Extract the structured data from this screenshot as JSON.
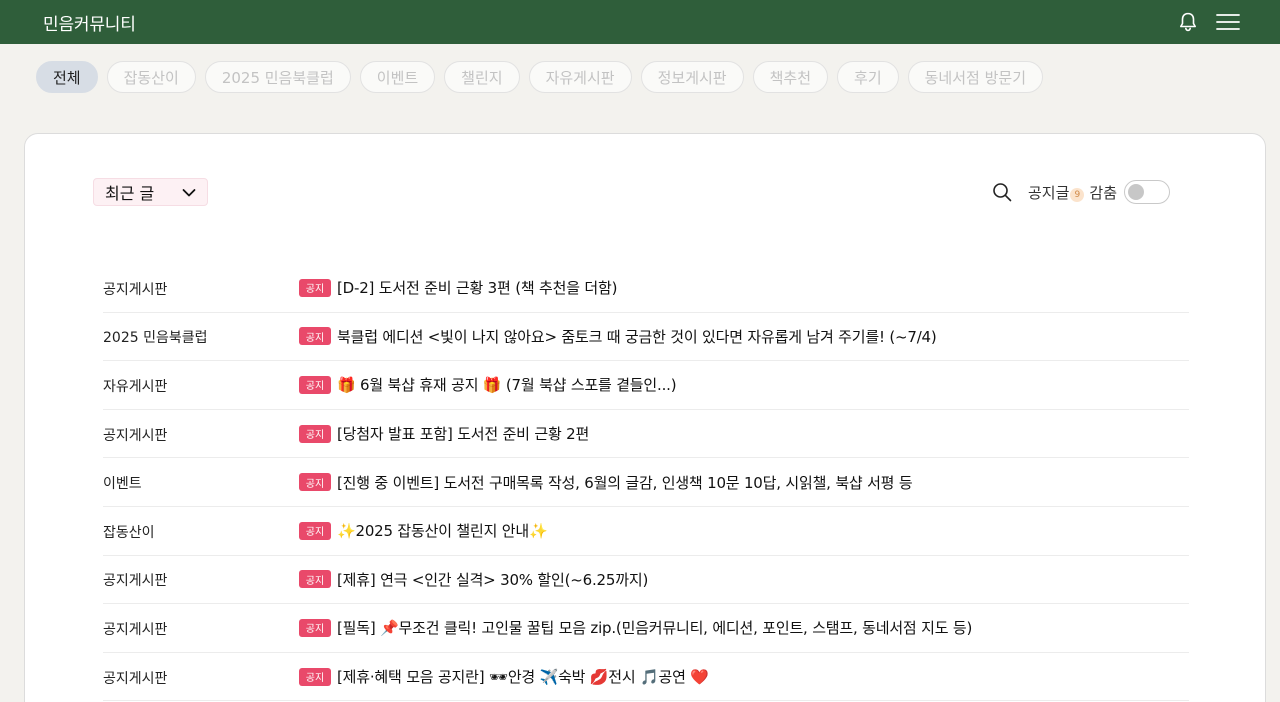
{
  "header": {
    "brand": "민음커뮤니티",
    "icons": [
      "bell-icon",
      "menu-icon"
    ]
  },
  "tabs": [
    {
      "label": "전체",
      "active": true
    },
    {
      "label": "잡동산이",
      "active": false
    },
    {
      "label": "2025 민음북클럽",
      "active": false
    },
    {
      "label": "이벤트",
      "active": false
    },
    {
      "label": "챌린지",
      "active": false
    },
    {
      "label": "자유게시판",
      "active": false
    },
    {
      "label": "정보게시판",
      "active": false
    },
    {
      "label": "책추천",
      "active": false
    },
    {
      "label": "후기",
      "active": false
    },
    {
      "label": "동네서점 방문기",
      "active": false
    }
  ],
  "toolbar": {
    "sort_label": "최근 글",
    "notice_label": "공지글",
    "notice_count": "9",
    "hide_label": "감춤",
    "hide_toggle_on": false
  },
  "posts": [
    {
      "category": "공지게시판",
      "badge": "공지",
      "title": "[D-2] 도서전 준비 근황 3편 (책 추천을 더함)"
    },
    {
      "category": "2025 민음북클럽",
      "badge": "공지",
      "title": "북클럽 에디션 <빛이 나지 않아요> 줌토크 때 궁금한 것이 있다면 자유롭게 남겨 주기를! (~7/4)"
    },
    {
      "category": "자유게시판",
      "badge": "공지",
      "title": "🎁 6월 북샵 휴재 공지 🎁 (7월 북샵 스포를 곁들인...)"
    },
    {
      "category": "공지게시판",
      "badge": "공지",
      "title": "[당첨자 발표 포함] 도서전 준비 근황 2편"
    },
    {
      "category": "이벤트",
      "badge": "공지",
      "title": "[진행 중 이벤트] 도서전 구매목록 작성, 6월의 글감, 인생책 10문 10답, 시읽챌, 북샵 서평 등"
    },
    {
      "category": "잡동산이",
      "badge": "공지",
      "title": "✨2025 잡동산이 챌린지 안내✨"
    },
    {
      "category": "공지게시판",
      "badge": "공지",
      "title": "[제휴] 연극 <인간 실격> 30% 할인(~6.25까지)"
    },
    {
      "category": "공지게시판",
      "badge": "공지",
      "title": "[필독] 📌무조건 클릭! 고인물 꿀팁 모음 zip.(민음커뮤니티, 에디션, 포인트, 스탬프, 동네서점 지도 등)"
    },
    {
      "category": "공지게시판",
      "badge": "공지",
      "title": "[제휴·혜택 모음 공지란] 🕶안경 ✈️숙박 💋전시 🎵공연 ❤️"
    }
  ]
}
